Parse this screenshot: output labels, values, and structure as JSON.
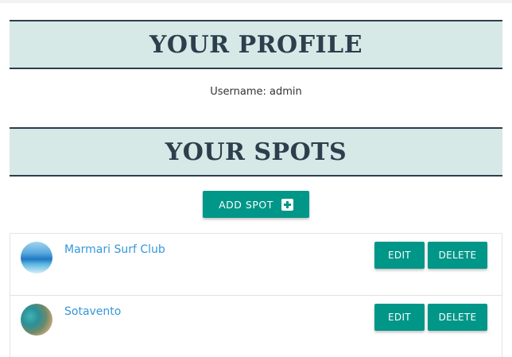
{
  "profile": {
    "title": "YOUR PROFILE",
    "username_text": "Username: admin"
  },
  "spots": {
    "title": "YOUR SPOTS",
    "add_label": "ADD SPOT",
    "add_icon": "plus-square-icon",
    "items": [
      {
        "name": "Marmari Surf Club",
        "edit_label": "EDIT",
        "delete_label": "DELETE"
      },
      {
        "name": "Sotavento",
        "edit_label": "EDIT",
        "delete_label": "DELETE"
      }
    ]
  },
  "colors": {
    "accent": "#009688",
    "banner_bg": "#d7e9e7",
    "banner_text": "#2d3e4c",
    "link": "#3498db"
  }
}
